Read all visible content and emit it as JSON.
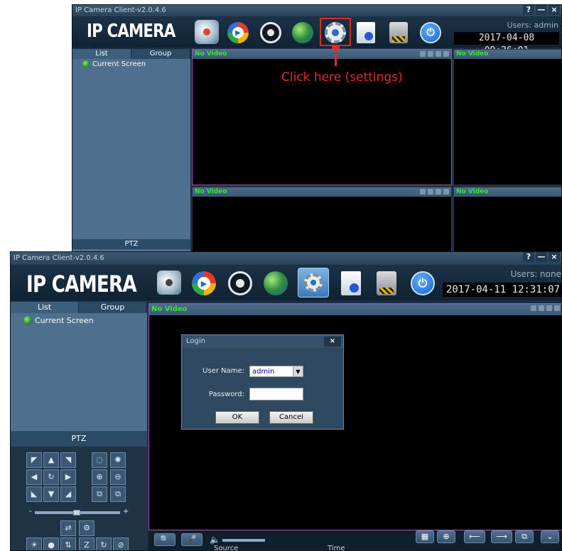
{
  "top_window": {
    "title": "IP Camera Client-v2.0.4.6",
    "window_buttons": [
      "?",
      "—",
      "×"
    ],
    "logo": "IP CAMERA",
    "users": "Users: admin",
    "clock": "2017-04-08  09:36:01",
    "tabs": [
      "List",
      "Group"
    ],
    "tree_item": "Current Screen",
    "ptz_label": "PTZ",
    "video_label": "No Video",
    "annotation": "Click here (settings)"
  },
  "bottom_window": {
    "title": "IP Camera Client-v2.0.4.6",
    "window_buttons": [
      "?",
      "—",
      "×"
    ],
    "logo": "IP CAMERA",
    "users": "Users: none",
    "clock": "2017-04-11  12:31:07",
    "tabs": [
      "List",
      "Group"
    ],
    "tree_item": "Current Screen",
    "ptz_label": "PTZ",
    "video_label": "No Video",
    "slider_minus": "-",
    "slider_plus": "+",
    "columns": [
      "Source",
      "Time"
    ],
    "login": {
      "title": "Login",
      "close": "×",
      "username_label": "User Name:",
      "username_value": "admin",
      "password_label": "Password:",
      "ok": "OK",
      "cancel": "Cancel"
    }
  },
  "colors": {
    "accent_red": "#e02a2a",
    "video_label_green": "#35e235",
    "panel_blue": "#4e6f8d",
    "selected_border": "#b14ab5"
  },
  "icons": [
    "camera-icon",
    "playback-icon",
    "ptz-wheel-icon",
    "globe-icon",
    "settings-gear-icon",
    "log-icon",
    "lock-icon",
    "power-icon"
  ]
}
